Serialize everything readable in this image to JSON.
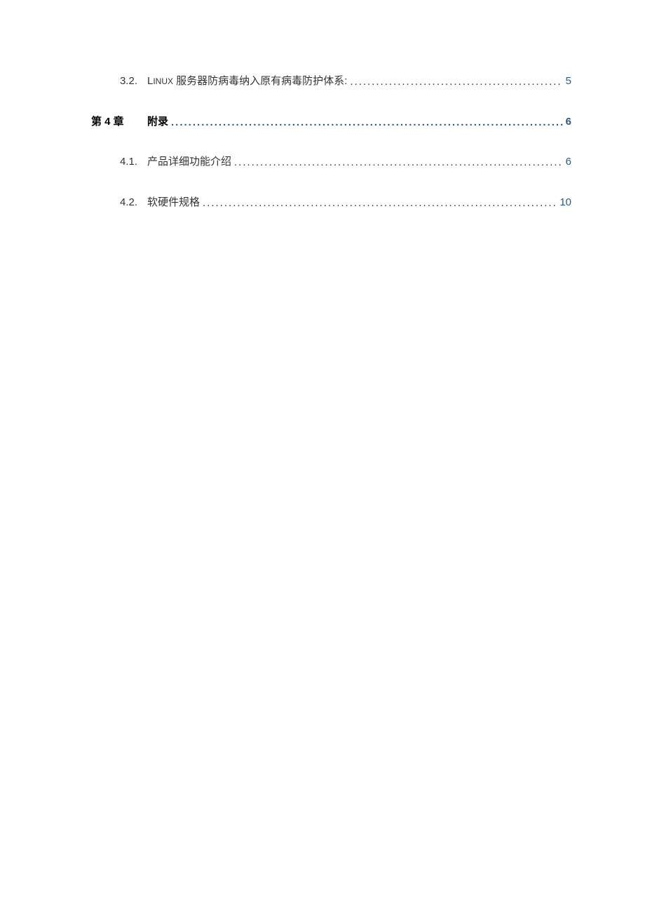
{
  "toc": {
    "entries": [
      {
        "number": "3.2.",
        "title_prefix": "L",
        "title_suffix": "INUX",
        "title_rest": " 服务器防病毒纳入原有病毒防护体系:",
        "page": "5",
        "is_chapter": false
      },
      {
        "number": "第 4 章",
        "title": "附录",
        "page": "6",
        "is_chapter": true
      },
      {
        "number": "4.1.",
        "title": "产品详细功能介绍",
        "page": "6",
        "is_chapter": false
      },
      {
        "number": "4.2.",
        "title": "软硬件规格",
        "page": "10",
        "is_chapter": false
      }
    ]
  },
  "dots": "........................................................................................................................................................................................................................"
}
